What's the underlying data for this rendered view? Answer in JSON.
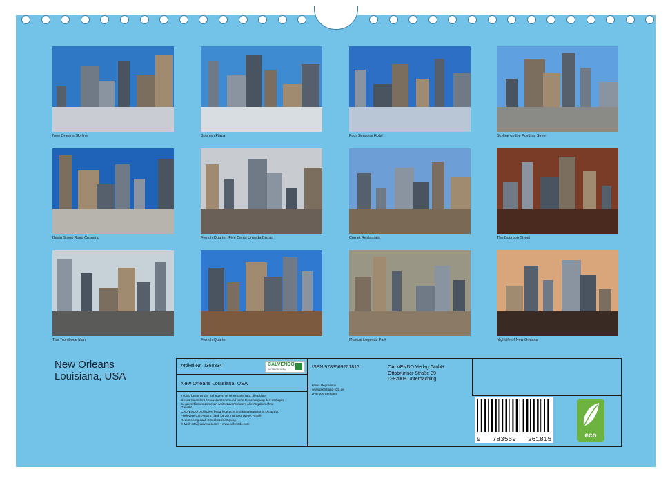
{
  "photos": [
    {
      "caption": "New Orleans Skyline",
      "sky": "#2f78c6",
      "ground": "#c9ccd2"
    },
    {
      "caption": "Spanish Plaza",
      "sky": "#3f8bd2",
      "ground": "#d8dde2"
    },
    {
      "caption": "Four Seasons Hotel",
      "sky": "#2d6fc4",
      "ground": "#b8c6d6"
    },
    {
      "caption": "Skyline on the Poydras Street",
      "sky": "#5fa0e0",
      "ground": "#8a8a86"
    },
    {
      "caption": "Basin Street Road Crossing",
      "sky": "#1f63b8",
      "ground": "#b7b4ae"
    },
    {
      "caption": "French Quarter: Five Cents Uneeda Biscuit",
      "sky": "#c8ccd0",
      "ground": "#6a6058"
    },
    {
      "caption": "Cornet Restaurant",
      "sky": "#6d9fd6",
      "ground": "#7a6a55"
    },
    {
      "caption": "The Bourbon Street",
      "sky": "#7a3c26",
      "ground": "#4a2a1e"
    },
    {
      "caption": "The Trombone Man",
      "sky": "#c6d2d8",
      "ground": "#5a5a58"
    },
    {
      "caption": "French Quarter",
      "sky": "#2f7ad0",
      "ground": "#7b5a40"
    },
    {
      "caption": "Musical Legends Park",
      "sky": "#9a9686",
      "ground": "#8a7a66"
    },
    {
      "caption": "Nightlife of New Orleans",
      "sky": "#d9a57a",
      "ground": "#3a2a24"
    }
  ],
  "title": {
    "line1": "New Orleans",
    "line2": "Louisiana, USA"
  },
  "info": {
    "article": "Artikel-Nr. 2368334",
    "calvendo_logo": "CALVENDO",
    "calvendo_sub": "Der Kalenderverlag",
    "product_title": "New Orleans Louisiana, USA",
    "legal": [
      "Infolge bestehender Schutzrechte ist es untersagt, die Blätter",
      "dieses Kalenders herauszutrennen und ohne Genehmigung des Verlages",
      "zu gewerblichen Zwecken weiterzuverwenden. Alle Angaben ohne",
      "Gewähr.",
      "CALVENDO produziert bedarfsgerecht und klimabewusst in DE & EU.",
      "Positivere CO2-Bilanz dank kürzer Transportwege. Abfall-",
      "Reduzierung dank Einzelstückfertigung.",
      "E-Mail: info@calvendo.com • www.calvendo.com"
    ],
    "isbn": "ISBN 9783569261815",
    "author": [
      "Klaus Hegmanns",
      "www.grenzland-foto.de",
      "D-47906 Kempen"
    ],
    "publisher": [
      "CALVENDO Verlag GmbH",
      "Ottobrunner Straße 39",
      "D-82008 Unterhaching"
    ],
    "barcode_digits": "9   783569   261815",
    "eco_label": "eco"
  },
  "colors": {
    "page_bg": "#73c2e8",
    "eco_green": "#6db33f",
    "border": "#1c1c1c"
  }
}
